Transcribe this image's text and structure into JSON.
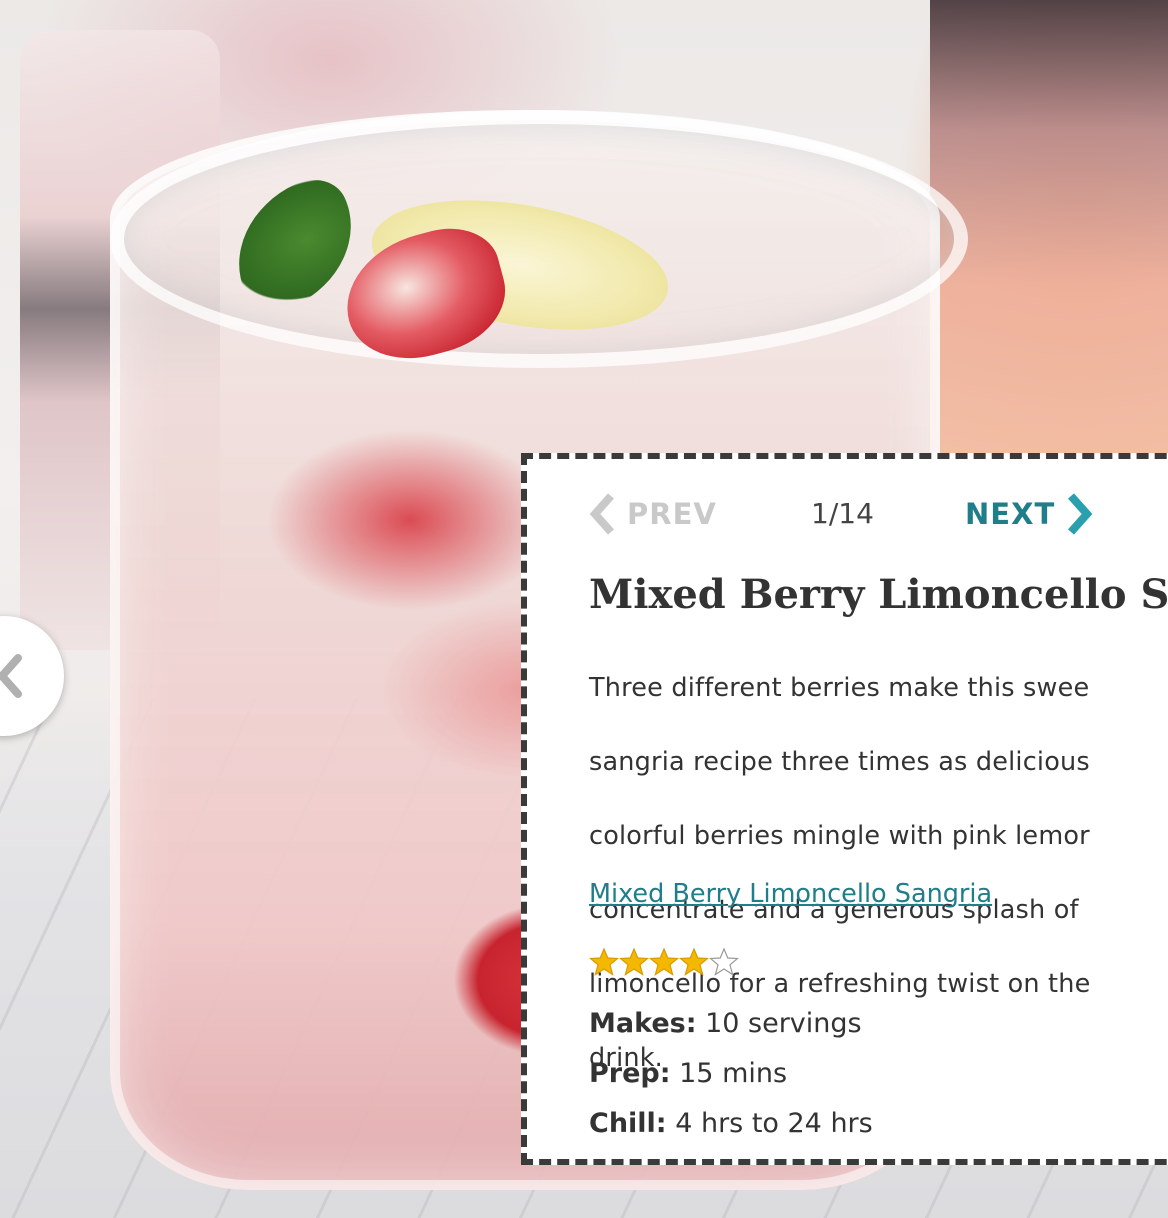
{
  "pager": {
    "prev_label": "PREV",
    "counter": "1/14",
    "next_label": "NEXT",
    "prev_color": "#c9c9c9",
    "next_color": "#1f7e8a"
  },
  "recipe": {
    "title": "Mixed Berry Limoncello S",
    "description_lines": [
      "Three different berries make this swee",
      "sangria recipe three times as delicious",
      "colorful berries mingle with pink lemor",
      "concentrate and a generous splash of",
      "limoncello for a refreshing twist on the",
      "drink."
    ],
    "link_text": "Mixed Berry Limoncello Sangria",
    "rating": 4,
    "rating_max": 5,
    "star_color": "#f5b800",
    "facts": [
      {
        "label": "Makes:",
        "value": " 10 servings"
      },
      {
        "label": "Prep:",
        "value": " 15 mins"
      },
      {
        "label": "Chill:",
        "value": " 4 hrs to 24 hrs"
      }
    ]
  },
  "icons": {
    "side_arrow": "chevron-left-icon",
    "prev": "chevron-left-icon",
    "next": "chevron-right-icon",
    "star": "star-icon"
  }
}
